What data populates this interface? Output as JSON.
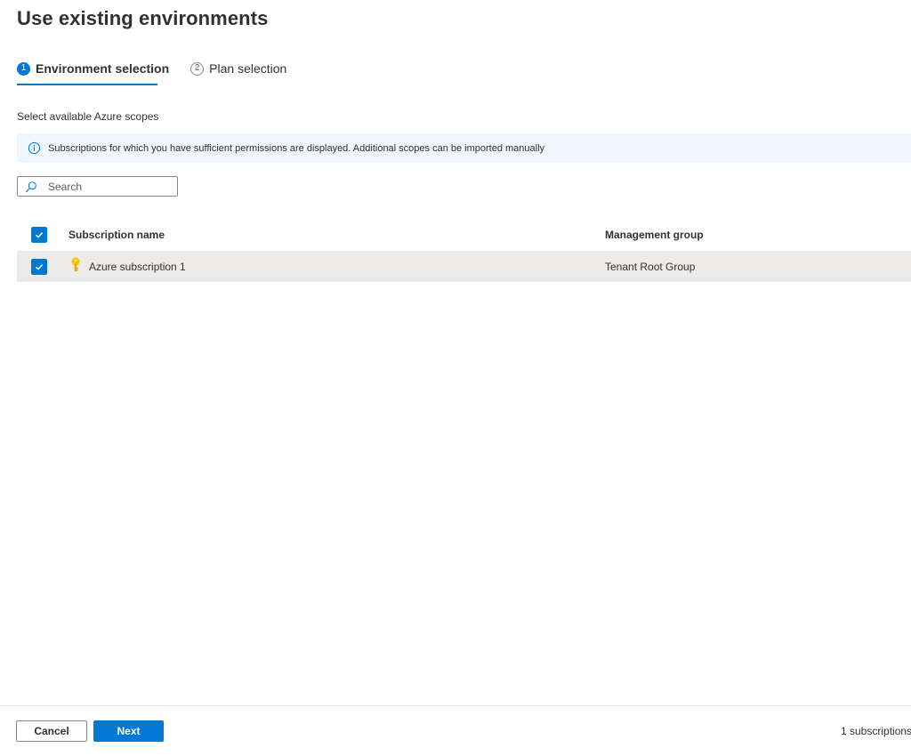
{
  "page": {
    "title": "Use existing environments"
  },
  "steps": [
    {
      "number": "1",
      "label": "Environment selection",
      "state": "active"
    },
    {
      "number": "2",
      "label": "Plan selection",
      "state": "inactive"
    }
  ],
  "main": {
    "section_label": "Select available Azure scopes",
    "info_message": "Subscriptions for which you have sufficient permissions are displayed. Additional scopes can be imported manually",
    "search": {
      "placeholder": "Search",
      "value": ""
    }
  },
  "table": {
    "columns": {
      "name": "Subscription name",
      "group": "Management group"
    },
    "header_checked": true,
    "rows": [
      {
        "name": "Azure subscription 1",
        "group": "Tenant Root Group",
        "checked": true,
        "icon": "key-icon"
      }
    ]
  },
  "footer": {
    "cancel_label": "Cancel",
    "next_label": "Next",
    "status": "1 subscriptions"
  },
  "colors": {
    "accent": "#0078d4",
    "info_background": "#eff6fc",
    "row_selected": "#edebe9",
    "key_icon": "#f8c100"
  }
}
